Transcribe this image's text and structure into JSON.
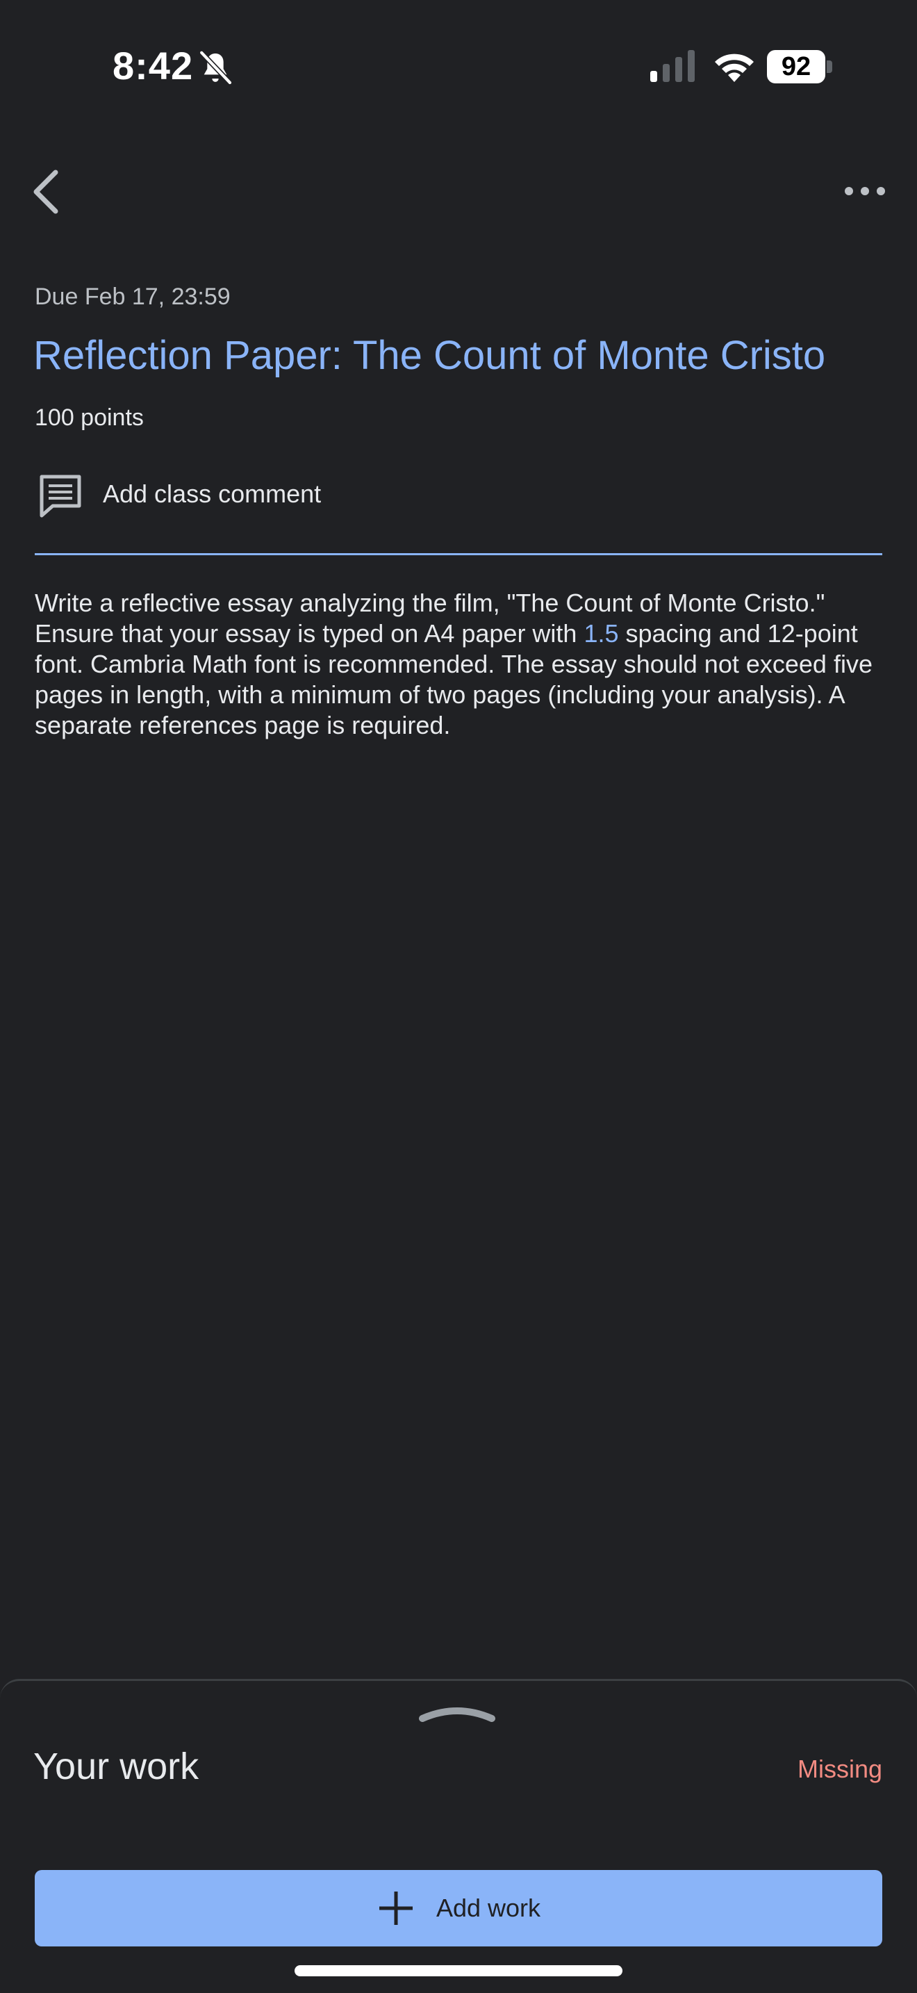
{
  "status_bar": {
    "time": "8:42",
    "battery": "92"
  },
  "assignment": {
    "due": "Due Feb 17, 23:59",
    "title": "Reflection Paper: The Count of Monte Cristo",
    "points": "100 points",
    "comment_label": "Add class comment",
    "description_part1": "Write a reflective essay analyzing the film, \"The Count of Monte Cristo.\" Ensure that your essay is typed on A4 paper with ",
    "description_highlight": "1.5",
    "description_part2": " spacing and 12-point font. Cambria Math font is recommended. The essay should not exceed five pages in length, with a minimum of two pages (including your analysis). A separate references page is required."
  },
  "your_work": {
    "heading": "Your work",
    "status": "Missing",
    "add_label": "Add work"
  },
  "icons": {
    "back": "back-chevron-icon",
    "more": "more-horizontal-icon",
    "comment": "comment-icon",
    "add": "plus-icon",
    "silent": "bell-off-icon"
  },
  "colors": {
    "background": "#202124",
    "accent": "#8ab4f8",
    "missing": "#f28b82",
    "text": "#e8eaed"
  }
}
